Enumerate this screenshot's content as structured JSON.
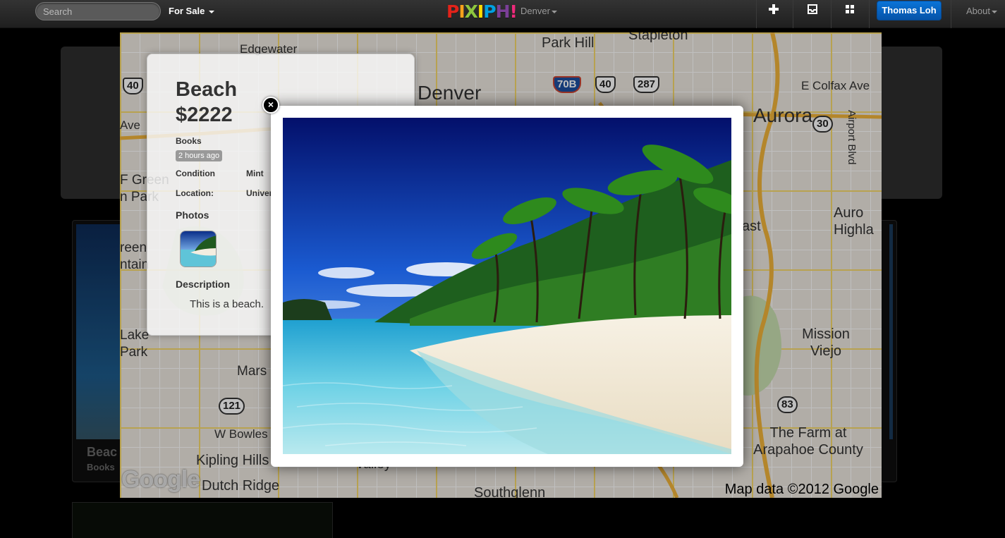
{
  "navbar": {
    "search_placeholder": "Search",
    "listing_type": "For Sale",
    "logo": [
      "P",
      "I",
      "X",
      "I",
      "P",
      "H",
      "!"
    ],
    "logo_colors": [
      "#e2231a",
      "#f7a21b",
      "#8dc63f",
      "#ffdd00",
      "#00a0e0",
      "#7b3f98",
      "#ee2a7b"
    ],
    "city": "Denver",
    "icons": [
      "plus-icon",
      "inbox-icon",
      "grid-icon"
    ],
    "user": "Thomas Loh",
    "about": "About"
  },
  "map": {
    "labels": [
      {
        "text": "Edgewater",
        "size": 17
      },
      {
        "text": "Park Hill",
        "size": 20
      },
      {
        "text": "Stapleton",
        "size": 20
      },
      {
        "text": "Denver",
        "size": 28
      },
      {
        "text": "Aurora",
        "size": 28
      },
      {
        "text": "E Colfax Ave",
        "size": 17
      },
      {
        "text": "Airport Blvd",
        "size": 15
      },
      {
        "text": "Auro Highla",
        "size": 20
      },
      {
        "text": "Mission Viejo",
        "size": 20
      },
      {
        "text": "The Farm at Arapahoe County",
        "size": 20
      },
      {
        "text": "Ave",
        "size": 17
      },
      {
        "text": "F Green n Park",
        "size": 19
      },
      {
        "text": "reen ntain",
        "size": 19
      },
      {
        "text": "Lake Park",
        "size": 19
      },
      {
        "text": "Mars",
        "size": 19
      },
      {
        "text": "W Bowles",
        "size": 17
      },
      {
        "text": "Kipling Hills",
        "size": 20
      },
      {
        "text": "Dutch Ridge",
        "size": 20
      },
      {
        "text": "Southglenn",
        "size": 20
      },
      {
        "text": "ast",
        "size": 20
      },
      {
        "text": "Valley",
        "size": 19
      }
    ],
    "shields": [
      {
        "text": "40",
        "type": "us"
      },
      {
        "text": "70B",
        "type": "interstate"
      },
      {
        "text": "40",
        "type": "us"
      },
      {
        "text": "287",
        "type": "us"
      },
      {
        "text": "30",
        "type": "state"
      },
      {
        "text": "121",
        "type": "state"
      },
      {
        "text": "83",
        "type": "state"
      }
    ],
    "logo": "Google",
    "credit": "Map data ©2012 Google"
  },
  "listing": {
    "title": "Beach",
    "price": "$2222",
    "category": "Books",
    "posted": "2 hours ago",
    "fields": [
      {
        "key": "Condition",
        "value": "Mint"
      },
      {
        "key": "Location:",
        "value": "Univer"
      }
    ],
    "photos_heading": "Photos",
    "description_heading": "Description",
    "description": "This is a beach."
  },
  "background": {
    "card_title": "Beac",
    "card_category": "Books"
  },
  "lightbox": {
    "close": "×"
  }
}
